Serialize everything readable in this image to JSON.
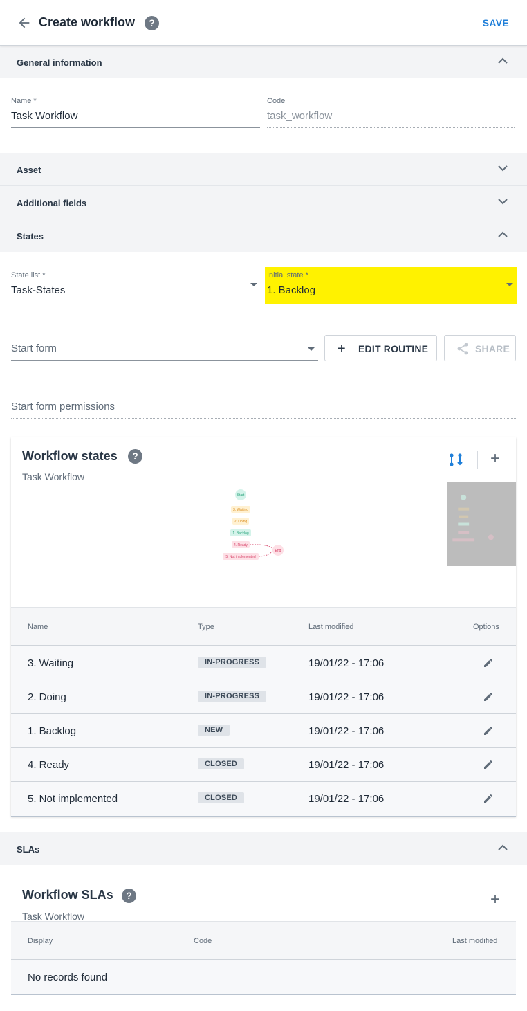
{
  "header": {
    "title": "Create workflow",
    "save_label": "SAVE",
    "help": "?"
  },
  "sections": {
    "general": {
      "label": "General information",
      "expanded": true
    },
    "asset": {
      "label": "Asset",
      "expanded": false
    },
    "additional": {
      "label": "Additional fields",
      "expanded": false
    },
    "states": {
      "label": "States",
      "expanded": true
    },
    "slas": {
      "label": "SLAs",
      "expanded": true
    }
  },
  "general": {
    "name_label": "Name *",
    "name_value": "Task Workflow",
    "code_label": "Code",
    "code_value": "task_workflow"
  },
  "states": {
    "state_list_label": "State list *",
    "state_list_value": "Task-States",
    "initial_state_label": "Initial state *",
    "initial_state_value": "1. Backlog",
    "start_form_placeholder": "Start form",
    "edit_routine_label": "EDIT ROUTINE",
    "share_label": "SHARE",
    "start_form_permissions_placeholder": "Start form permissions"
  },
  "workflow_states": {
    "title": "Workflow states",
    "subtitle": "Task Workflow",
    "diagram": {
      "start": "Start",
      "nodes": [
        "3. Waiting",
        "2. Doing",
        "1. Backlog",
        "4. Ready",
        "5. Not implemented"
      ],
      "end": "End"
    },
    "columns": {
      "name": "Name",
      "type": "Type",
      "last_modified": "Last modified",
      "options": "Options"
    },
    "rows": [
      {
        "name": "3. Waiting",
        "type": "IN-PROGRESS",
        "last_modified": "19/01/22 - 17:06"
      },
      {
        "name": "2. Doing",
        "type": "IN-PROGRESS",
        "last_modified": "19/01/22 - 17:06"
      },
      {
        "name": "1. Backlog",
        "type": "NEW",
        "last_modified": "19/01/22 - 17:06"
      },
      {
        "name": "4. Ready",
        "type": "CLOSED",
        "last_modified": "19/01/22 - 17:06"
      },
      {
        "name": "5. Not implemented",
        "type": "CLOSED",
        "last_modified": "19/01/22 - 17:06"
      }
    ]
  },
  "workflow_slas": {
    "title": "Workflow SLAs",
    "subtitle": "Task Workflow",
    "columns": {
      "display": "Display",
      "code": "Code",
      "last_modified": "Last modified"
    },
    "empty_text": "No records found"
  },
  "colors": {
    "accent": "#1f7fd9",
    "highlight": "#fff200",
    "section_bg": "#f3f4f6"
  }
}
